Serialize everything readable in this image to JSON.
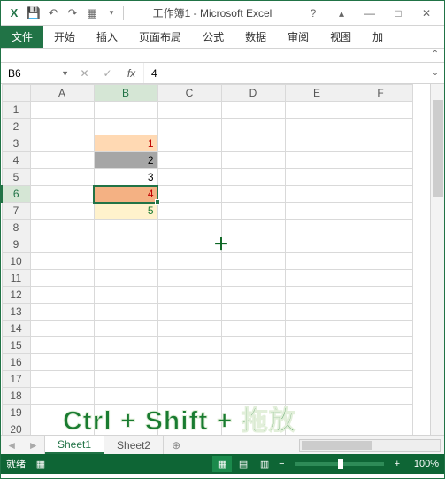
{
  "titlebar": {
    "doc_title": "工作簿1 - Microsoft Excel",
    "qa": {
      "excel_icon": "X",
      "save": "💾",
      "undo": "↶",
      "redo": "↷",
      "new": "▦",
      "dd": "▾"
    },
    "help": "?",
    "ribbon_opts": "▴",
    "min": "—",
    "max": "□",
    "close": "✕"
  },
  "ribbon": {
    "tabs": [
      "文件",
      "开始",
      "插入",
      "页面布局",
      "公式",
      "数据",
      "审阅",
      "视图",
      "加"
    ],
    "active_index": 0
  },
  "formula": {
    "name_box": "B6",
    "cancel": "✕",
    "enter": "✓",
    "fx": "fx",
    "value": "4"
  },
  "grid": {
    "columns": [
      "A",
      "B",
      "C",
      "D",
      "E",
      "F"
    ],
    "sel_col": "B",
    "rows": 20,
    "sel_row": 6,
    "cells": {
      "B3": {
        "v": "1",
        "cls": "c-peach txt-red"
      },
      "B4": {
        "v": "2",
        "cls": "c-grey"
      },
      "B5": {
        "v": "3",
        "cls": "c-white"
      },
      "B6": {
        "v": "4",
        "cls": "c-orange txt-red sel-cell"
      },
      "B7": {
        "v": "5",
        "cls": "c-lemon txt-green"
      }
    }
  },
  "overlay": "Ctrl + Shift + 拖放",
  "sheets": {
    "tabs": [
      "Sheet1",
      "Sheet2"
    ],
    "active_index": 0,
    "add": "⊕",
    "nav_prev": "◄",
    "nav_next": "►"
  },
  "status": {
    "mode": "就绪",
    "rec": "▦",
    "views": {
      "normal": "▦",
      "layout": "▤",
      "break": "▥"
    },
    "zoom_minus": "−",
    "zoom_plus": "+",
    "zoom": "100%"
  }
}
